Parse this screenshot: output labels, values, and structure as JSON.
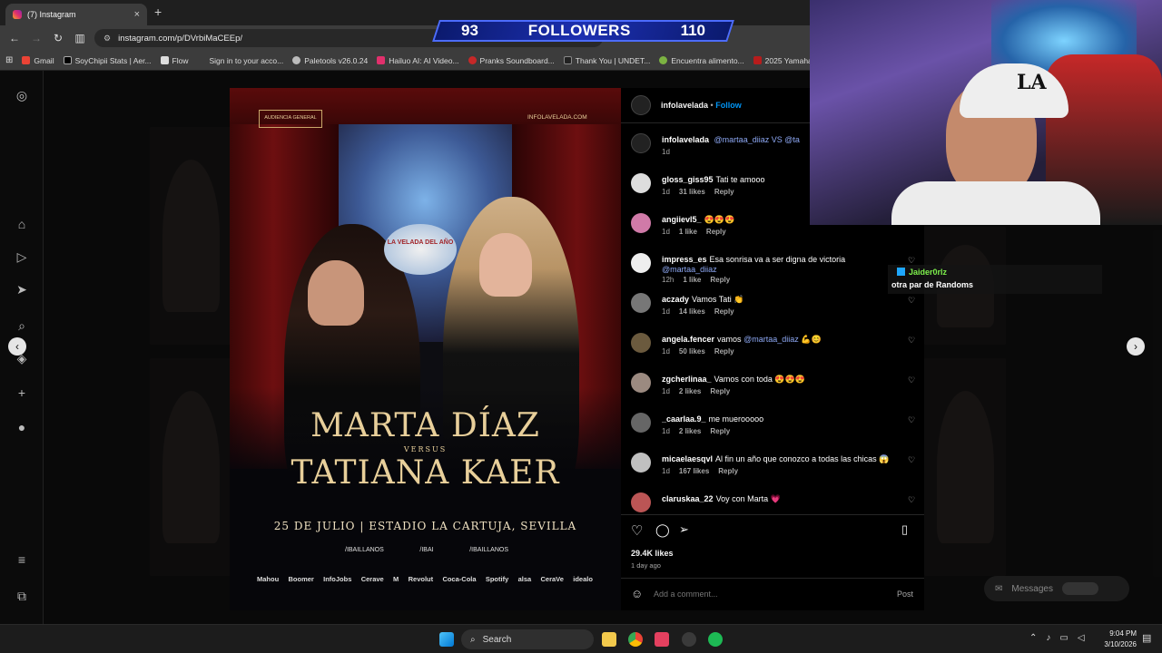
{
  "browser": {
    "tab_title": "(7) Instagram",
    "new_tab": "+",
    "close": "×",
    "url": "instagram.com/p/DVrbiMaCEEp/",
    "bookmarks": [
      "Gmail",
      "SoyChipii Stats | Aer...",
      "Flow",
      "Sign in to your acco...",
      "Paletools v26.0.24",
      "Hailuo AI: AI Video...",
      "Pranks Soundboard...",
      "Thank You | UNDET...",
      "Encuentra alimento...",
      "2025 Yamaha"
    ]
  },
  "followers_overlay": {
    "left": "93",
    "label": "FOLLOWERS",
    "right": "110"
  },
  "poster": {
    "badge": "AUDIENCIA GENERAL",
    "site": "INFOLAVELADA.COM",
    "logo": "LA VELADA DEL AÑO",
    "name1": "MARTA DÍAZ",
    "versus": "VERSUS",
    "name2": "TATIANA KAER",
    "date_line": "25 DE JULIO | ESTADIO LA CARTUJA, SEVILLA",
    "socials": [
      "/IBAILLANOS",
      "/IBAI",
      "/IBAILLANOS"
    ],
    "sponsors": [
      "Mahou",
      "Boomer",
      "InfoJobs",
      "Cerave",
      "M",
      "Revolut",
      "Coca-Cola",
      "Spotify",
      "alsa",
      "CeraVe",
      "idealo"
    ]
  },
  "post": {
    "author": "infolavelada",
    "follow": "Follow",
    "caption_user": "infolavelada",
    "caption_text": "@martaa_diiaz VS @ta",
    "caption_time": "1d",
    "comments": [
      {
        "user": "gloss_giss95",
        "text": "Tati te amooo",
        "mention": "",
        "time": "1d",
        "likes": "31 likes",
        "reply": "Reply"
      },
      {
        "user": "angiievl5_",
        "text": "😍😍😍",
        "mention": "",
        "time": "1d",
        "likes": "1 like",
        "reply": "Reply"
      },
      {
        "user": "impress_es",
        "text": "Esa sonrisa va a ser digna de victoria",
        "mention": "@martaa_diiaz",
        "time": "12h",
        "likes": "1 like",
        "reply": "Reply"
      },
      {
        "user": "aczady",
        "text": "Vamos Tati 👏",
        "mention": "",
        "time": "1d",
        "likes": "14 likes",
        "reply": "Reply"
      },
      {
        "user": "angela.fencer",
        "text": "vamos",
        "mention": "@martaa_diiaz",
        "after": "💪😊",
        "time": "1d",
        "likes": "50 likes",
        "reply": "Reply"
      },
      {
        "user": "zgcherlinaa_",
        "text": "Vamos con toda 😍😍😍",
        "mention": "",
        "time": "1d",
        "likes": "2 likes",
        "reply": "Reply"
      },
      {
        "user": "_caarlaa.9_",
        "text": "me muerooooo",
        "mention": "",
        "time": "1d",
        "likes": "2 likes",
        "reply": "Reply"
      },
      {
        "user": "micaelaesqvl",
        "text": "Al fin un año que conozco a todas las chicas 😱",
        "mention": "",
        "time": "1d",
        "likes": "167 likes",
        "reply": "Reply"
      },
      {
        "user": "claruskaa_22",
        "text": "Voy con Marta 💗",
        "mention": "",
        "time": "",
        "likes": "",
        "reply": ""
      }
    ],
    "likes": "29.4K likes",
    "posted": "1 day ago",
    "comment_placeholder": "Add a comment...",
    "post_btn": "Post"
  },
  "chat_overlay": {
    "user": "Jaider0rlz",
    "message": "otra par de Randoms"
  },
  "messages_label": "Messages",
  "taskbar": {
    "search": "Search",
    "time": "9:04 PM",
    "date": "3/10/2026"
  },
  "colors": {
    "accent": "#0095f6",
    "mention": "#8ea9f5",
    "chat_green": "#7ef04c"
  }
}
